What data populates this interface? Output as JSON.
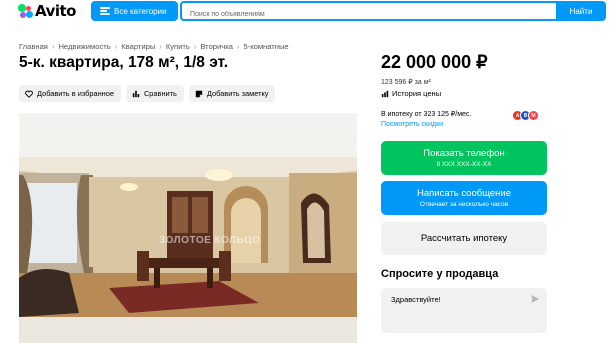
{
  "header": {
    "logo_text": "Avito",
    "categories_label": "Все категории",
    "search_placeholder": "Поиск по объявлениям",
    "find_label": "Найти"
  },
  "breadcrumbs": [
    "Главная",
    "Недвижимость",
    "Квартиры",
    "Купить",
    "Вторичка",
    "5-комнатные"
  ],
  "listing": {
    "title": "5-к. квартира, 178 м², 1/8 эт.",
    "actions": {
      "favorite": "Добавить в избранное",
      "compare": "Сравнить",
      "note": "Добавить заметку"
    },
    "watermark": "ЗОЛОТОЕ КОЛЬЦО"
  },
  "price": {
    "total": "22 000 000 ₽",
    "per_m2": "123 596 ₽ за м²",
    "history_label": "История цены",
    "mortgage_text": "В ипотеку от 323 125 ₽/мес.",
    "discounts_link": "Посмотреть скидки"
  },
  "contact": {
    "phone_button": "Показать телефон",
    "phone_masked": "8 XXX XXX-XX-XX",
    "message_button": "Написать сообщение",
    "message_sub": "Отвечает за несколько часов",
    "mortgage_button": "Рассчитать ипотеку"
  },
  "ask_seller": {
    "title": "Спросите у продавца",
    "message": "Здравствуйте!"
  },
  "colors": {
    "accent_blue": "#0099f7",
    "phone_green": "#00c45e",
    "button_gray": "#f2f1f0"
  }
}
